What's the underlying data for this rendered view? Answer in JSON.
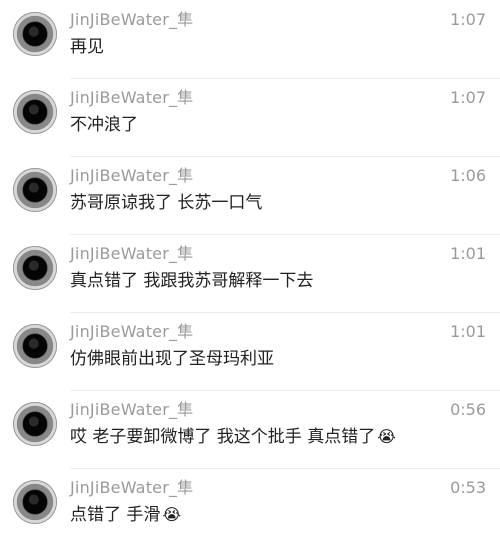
{
  "comments": [
    {
      "user": "JinJiBeWater_隼",
      "time": "1:07",
      "text": "再见",
      "emoji": ""
    },
    {
      "user": "JinJiBeWater_隼",
      "time": "1:07",
      "text": "不冲浪了",
      "emoji": ""
    },
    {
      "user": "JinJiBeWater_隼",
      "time": "1:06",
      "text": "苏哥原谅我了 长苏一口气",
      "emoji": ""
    },
    {
      "user": "JinJiBeWater_隼",
      "time": "1:01",
      "text": "真点错了 我跟我苏哥解释一下去",
      "emoji": ""
    },
    {
      "user": "JinJiBeWater_隼",
      "time": "1:01",
      "text": "仿佛眼前出现了圣母玛利亚",
      "emoji": ""
    },
    {
      "user": "JinJiBeWater_隼",
      "time": "0:56",
      "text": "哎 老子要卸微博了 我这个批手 真点错了",
      "emoji": "😭"
    },
    {
      "user": "JinJiBeWater_隼",
      "time": "0:53",
      "text": "点错了 手滑",
      "emoji": "😭"
    }
  ]
}
